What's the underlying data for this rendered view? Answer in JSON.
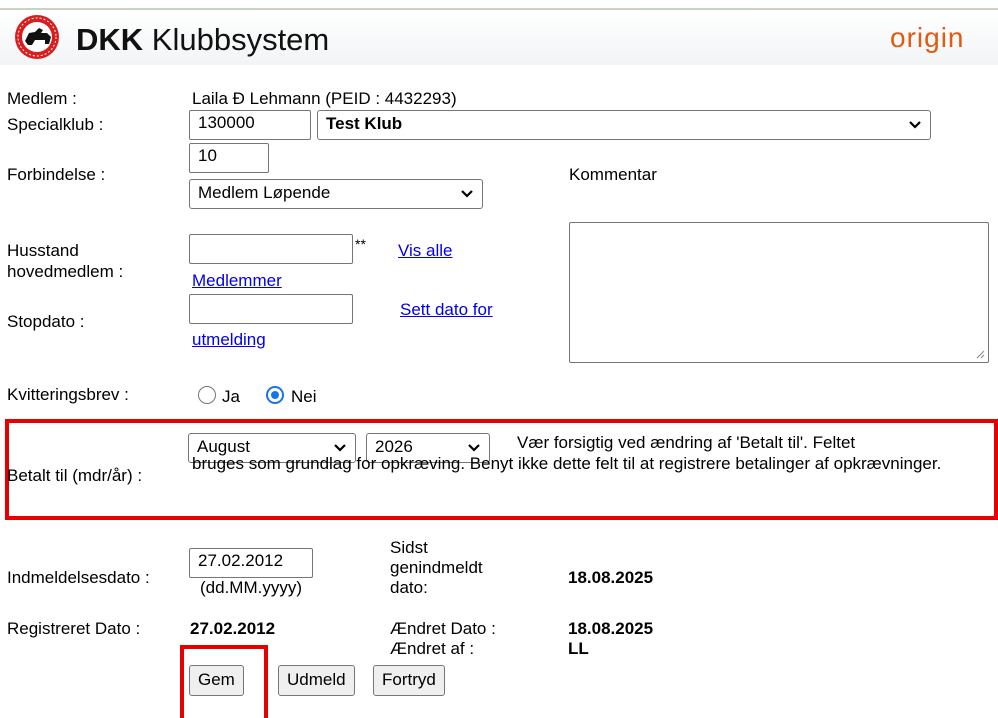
{
  "header": {
    "title_bold": "DKK",
    "title_rest": " Klubbsystem",
    "brand": "origin"
  },
  "member": {
    "label": "Medlem :",
    "value": "Laila Ð Lehmann  (PEID : 4432293)"
  },
  "club": {
    "label": "Specialklub :",
    "code": "130000",
    "name": "Test Klub"
  },
  "connection": {
    "label": "Forbindelse :",
    "code": "10",
    "type": "Medlem Løpende"
  },
  "comment": {
    "label": "Kommentar"
  },
  "household": {
    "label_line1": "Husstand",
    "label_line2": "hovedmedlem :",
    "value": "",
    "marker": "**",
    "link_show_all": "Vis alle",
    "link_members": "Medlemmer"
  },
  "stop_date": {
    "label": "Stopdato :",
    "value": "",
    "link_line1": "Sett dato for",
    "link_line2": "utmelding"
  },
  "receipt": {
    "label": "Kvitteringsbrev :",
    "yes": "Ja",
    "no": "Nei",
    "selected": "Nei"
  },
  "paid_until": {
    "label": "Betalt til (mdr/år) :",
    "month": "August",
    "separator": "/",
    "year": "2026",
    "note_line1": "Vær forsigtig ved ændring af 'Betalt til'. Feltet",
    "note_rest": "bruges som grundlag for opkræving. Benyt ikke dette felt til at registrere betalinger af opkrævninger."
  },
  "join_date": {
    "label": "Indmeldelsesdato :",
    "value": "27.02.2012",
    "format": "(dd.MM.yyyy)"
  },
  "rejoin": {
    "label_line1": "Sidst",
    "label_line2": "genindmeldt",
    "label_line3": "dato:",
    "value": "18.08.2025"
  },
  "registered": {
    "label": "Registreret Dato :",
    "value": "27.02.2012"
  },
  "changed": {
    "date_label": "Ændret Dato :",
    "date_value": "18.08.2025",
    "by_label": "Ændret af :",
    "by_value": "LL"
  },
  "buttons": {
    "save": "Gem",
    "unsubscribe": "Udmeld",
    "cancel": "Fortryd"
  }
}
